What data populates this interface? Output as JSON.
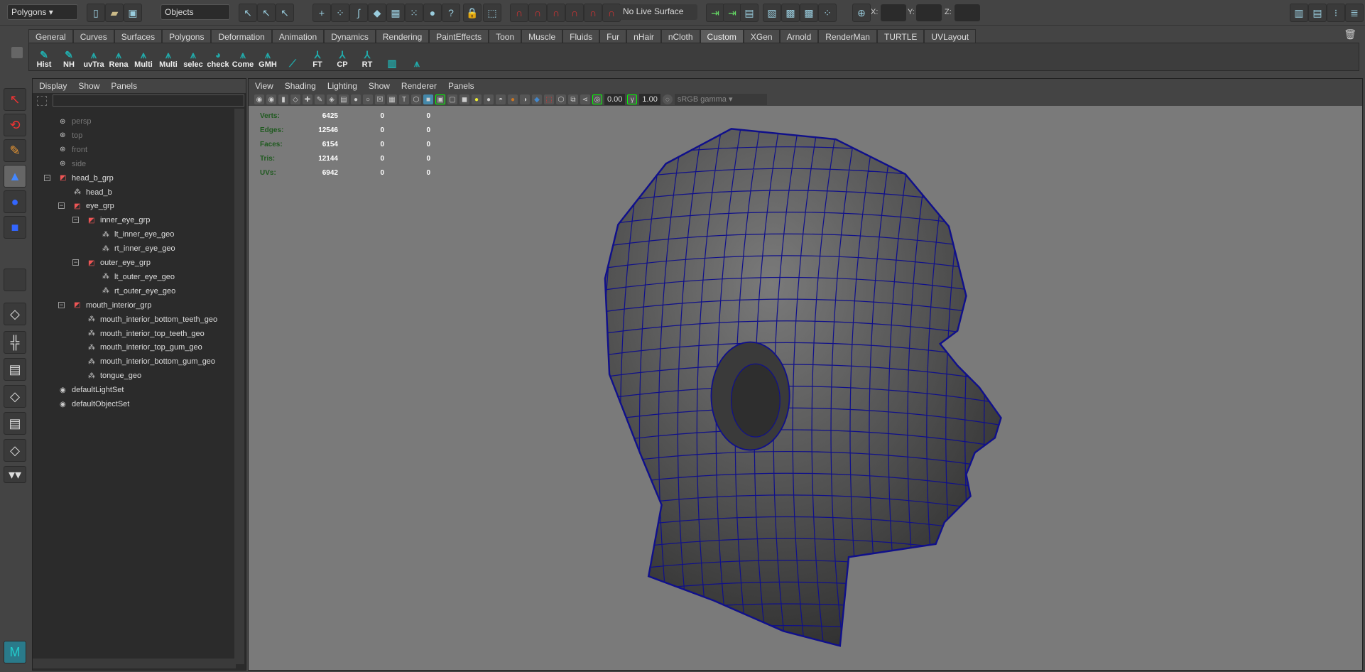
{
  "topbar": {
    "menu_set": "Polygons",
    "selection_mode": "Objects",
    "live_surface": "No Live Surface",
    "x_label": "X:",
    "y_label": "Y:",
    "z_label": "Z:"
  },
  "shelf": {
    "tabs": [
      "General",
      "Curves",
      "Surfaces",
      "Polygons",
      "Deformation",
      "Animation",
      "Dynamics",
      "Rendering",
      "PaintEffects",
      "Toon",
      "Muscle",
      "Fluids",
      "Fur",
      "nHair",
      "nCloth",
      "Custom",
      "XGen",
      "Arnold",
      "RenderMan",
      "TURTLE",
      "UVLayout"
    ],
    "active_tab": "Custom",
    "buttons": [
      "Hist",
      "NH",
      "uvTra",
      "Rena",
      "Multi",
      "Multi",
      "selec",
      "check",
      "Come",
      "GMH",
      "",
      "FT",
      "CP",
      "RT",
      "",
      ""
    ]
  },
  "outliner": {
    "menu": [
      "Display",
      "Show",
      "Panels"
    ],
    "items": [
      {
        "label": "persp",
        "level": 0,
        "type": "camera",
        "dim": true
      },
      {
        "label": "top",
        "level": 0,
        "type": "camera",
        "dim": true
      },
      {
        "label": "front",
        "level": 0,
        "type": "camera",
        "dim": true
      },
      {
        "label": "side",
        "level": 0,
        "type": "camera",
        "dim": true
      },
      {
        "label": "head_b_grp",
        "level": 0,
        "type": "group",
        "expanded": true
      },
      {
        "label": "head_b",
        "level": 1,
        "type": "mesh"
      },
      {
        "label": "eye_grp",
        "level": 1,
        "type": "group",
        "expanded": true
      },
      {
        "label": "inner_eye_grp",
        "level": 2,
        "type": "group",
        "expanded": true
      },
      {
        "label": "lt_inner_eye_geo",
        "level": 3,
        "type": "mesh"
      },
      {
        "label": "rt_inner_eye_geo",
        "level": 3,
        "type": "mesh"
      },
      {
        "label": "outer_eye_grp",
        "level": 2,
        "type": "group",
        "expanded": true
      },
      {
        "label": "lt_outer_eye_geo",
        "level": 3,
        "type": "mesh"
      },
      {
        "label": "rt_outer_eye_geo",
        "level": 3,
        "type": "mesh"
      },
      {
        "label": "mouth_interior_grp",
        "level": 1,
        "type": "group",
        "expanded": true
      },
      {
        "label": "mouth_interior_bottom_teeth_geo",
        "level": 2,
        "type": "mesh"
      },
      {
        "label": "mouth_interior_top_teeth_geo",
        "level": 2,
        "type": "mesh"
      },
      {
        "label": "mouth_interior_top_gum_geo",
        "level": 2,
        "type": "mesh"
      },
      {
        "label": "mouth_interior_bottom_gum_geo",
        "level": 2,
        "type": "mesh"
      },
      {
        "label": "tongue_geo",
        "level": 2,
        "type": "mesh"
      },
      {
        "label": "defaultLightSet",
        "level": 0,
        "type": "set"
      },
      {
        "label": "defaultObjectSet",
        "level": 0,
        "type": "set"
      }
    ]
  },
  "viewport": {
    "menu": [
      "View",
      "Shading",
      "Lighting",
      "Show",
      "Renderer",
      "Panels"
    ],
    "exposure": "0.00",
    "gamma": "1.00",
    "color_space": "sRGB gamma",
    "hud": [
      {
        "label": "Verts:",
        "values": [
          "6425",
          "0",
          "0"
        ]
      },
      {
        "label": "Edges:",
        "values": [
          "12546",
          "0",
          "0"
        ]
      },
      {
        "label": "Faces:",
        "values": [
          "6154",
          "0",
          "0"
        ]
      },
      {
        "label": "Tris:",
        "values": [
          "12144",
          "0",
          "0"
        ]
      },
      {
        "label": "UVs:",
        "values": [
          "6942",
          "0",
          "0"
        ]
      }
    ]
  },
  "colors": {
    "wire": "#10108a",
    "hud_label": "#1f5a1f",
    "viewport_bg": "#7a7a7a"
  }
}
